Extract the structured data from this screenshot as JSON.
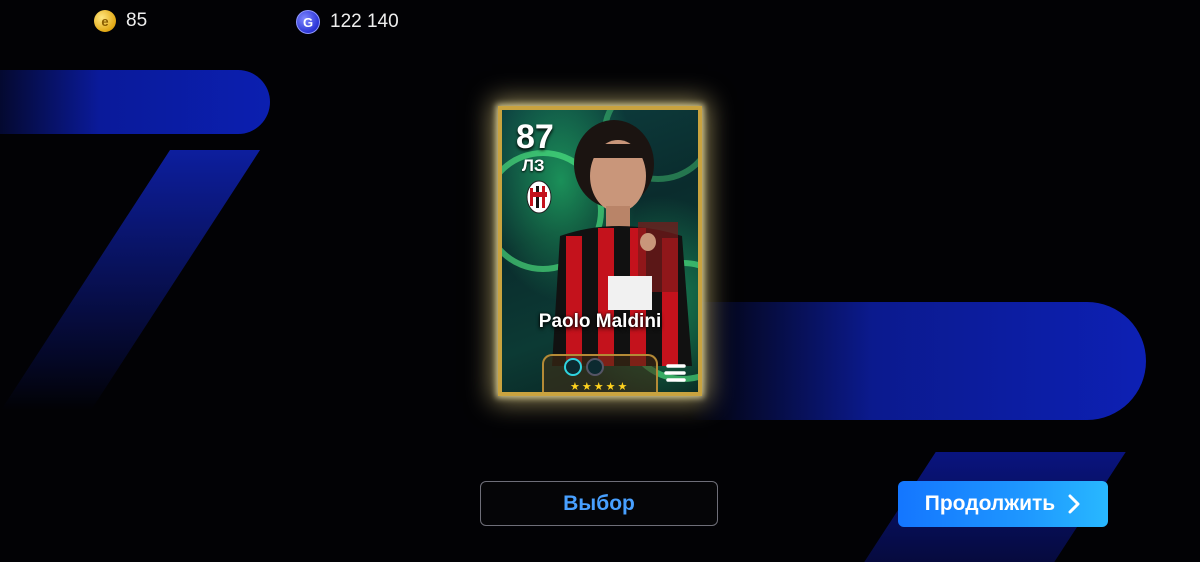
{
  "header": {
    "coins": {
      "icon": "efootball-coin-icon",
      "value": "85",
      "color": "#e8b21c"
    },
    "gp": {
      "icon": "gp-icon",
      "value": "122 140",
      "color": "#2f38e0"
    }
  },
  "card": {
    "rating": "87",
    "position": "ЛЗ",
    "club_badge_icon": "ac-milan-badge-icon",
    "player_name": "Paolo Maldini",
    "stars": "★★★★★",
    "brand_icon": "efootball-logo-icon",
    "frame_color": "#c9a33f",
    "glow_color": "#ffeb96"
  },
  "buttons": {
    "select_label": "Выбор",
    "continue_label": "Продолжить",
    "accent": "#1e8bff"
  }
}
